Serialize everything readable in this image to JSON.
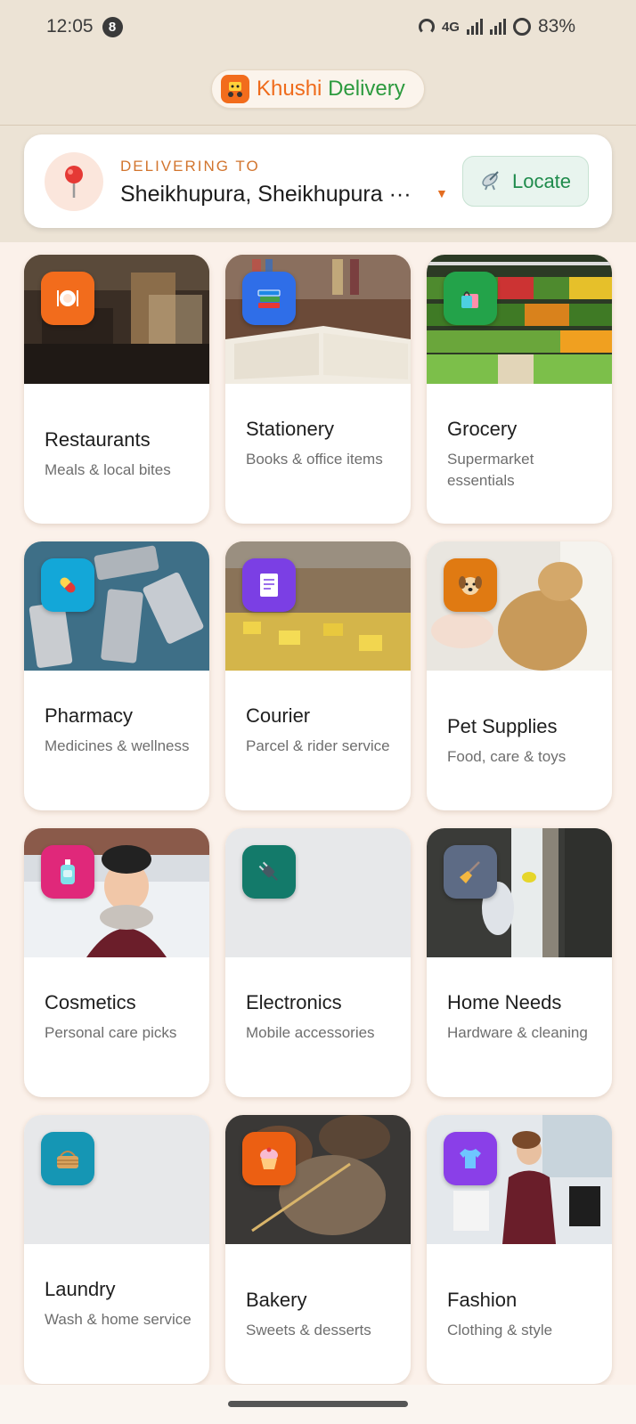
{
  "status_bar": {
    "time": "12:05",
    "notification_count": "8",
    "network": "4G",
    "battery": "83%"
  },
  "brand": {
    "name_part1": "Khushi",
    "name_part2": "Delivery",
    "logo_icon": "delivery-scooter-icon",
    "colors": {
      "orange": "#ef6b1b",
      "green": "#2c9a3e"
    }
  },
  "location": {
    "label": "DELIVERING TO",
    "value": "Sheikhupura, Sheikhupura ···",
    "locate_label": "Locate",
    "pin_icon": "map-pin-icon",
    "locate_icon": "satellite-dish-icon"
  },
  "categories": [
    {
      "title": "Restaurants",
      "subtitle": "Meals & local bites",
      "icon": "plate-icon",
      "icon_color": "#f26c1c"
    },
    {
      "title": "Stationery",
      "subtitle": "Books & office items",
      "icon": "books-icon",
      "icon_color": "#2f6ee8"
    },
    {
      "title": "Grocery",
      "subtitle": "Supermarket essentials",
      "icon": "shopping-bag-icon",
      "icon_color": "#23a34a"
    },
    {
      "title": "Pharmacy",
      "subtitle": "Medicines & wellness",
      "icon": "pill-icon",
      "icon_color": "#13a7d8"
    },
    {
      "title": "Courier",
      "subtitle": "Parcel & rider service",
      "icon": "receipt-icon",
      "icon_color": "#7b3fe4"
    },
    {
      "title": "Pet Supplies",
      "subtitle": "Food, care & toys",
      "icon": "dog-icon",
      "icon_color": "#e07a12"
    },
    {
      "title": "Cosmetics",
      "subtitle": "Personal care picks",
      "icon": "lotion-icon",
      "icon_color": "#e0287a"
    },
    {
      "title": "Electronics",
      "subtitle": "Mobile accessories",
      "icon": "plug-icon",
      "icon_color": "#137a6a"
    },
    {
      "title": "Home Needs",
      "subtitle": "Hardware & cleaning",
      "icon": "broom-icon",
      "icon_color": "#5d6b85"
    },
    {
      "title": "Laundry",
      "subtitle": "Wash & home service",
      "icon": "basket-icon",
      "icon_color": "#1596b4"
    },
    {
      "title": "Bakery",
      "subtitle": "Sweets & desserts",
      "icon": "cupcake-icon",
      "icon_color": "#ec5f12"
    },
    {
      "title": "Fashion",
      "subtitle": "Clothing & style",
      "icon": "tshirt-icon",
      "icon_color": "#8a3fe8"
    }
  ]
}
